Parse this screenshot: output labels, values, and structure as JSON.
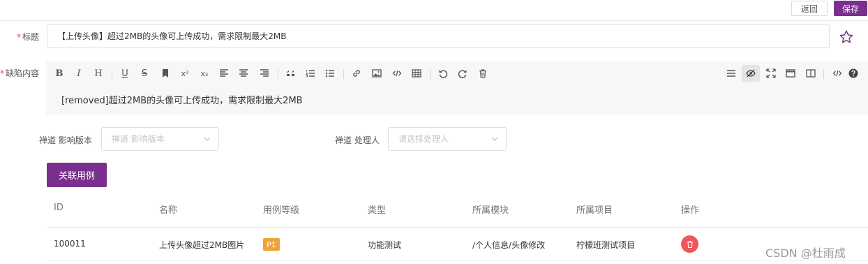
{
  "topbar": {
    "back_label": "返回",
    "save_label": "保存"
  },
  "title_field": {
    "required_mark": "*",
    "label": "标题",
    "value": "【上传头像】超过2MB的头像可上传成功，需求限制最大2MB"
  },
  "defect_field": {
    "required_mark": "*",
    "label": "缺陷内容",
    "content": "[removed]超过2MB的头像可上传成功，需求限制最大2MB"
  },
  "toolbar": {
    "bold": "B",
    "italic": "I",
    "heading": "H",
    "underline": "U",
    "strike": "S",
    "superscript": "x²",
    "subscript": "x₂"
  },
  "version_field": {
    "label": "禅道 影响版本",
    "placeholder": "禅道 影响版本"
  },
  "handler_field": {
    "label": "禅道 处理人",
    "placeholder": "请选择处理人"
  },
  "link_case_button": "关联用例",
  "table": {
    "headers": [
      "ID",
      "名称",
      "用例等级",
      "类型",
      "所属模块",
      "所属项目",
      "操作"
    ],
    "rows": [
      {
        "id": "100011",
        "name": "上传头像超过2MB图片",
        "level": "P1",
        "type": "功能测试",
        "module": "/个人信息/头像修改",
        "project": "柠檬班测试项目"
      }
    ]
  },
  "watermark": "CSDN @杜雨成",
  "colors": {
    "primary": "#7a2f8e",
    "badge": "#f0a23a",
    "danger": "#f0555a"
  }
}
